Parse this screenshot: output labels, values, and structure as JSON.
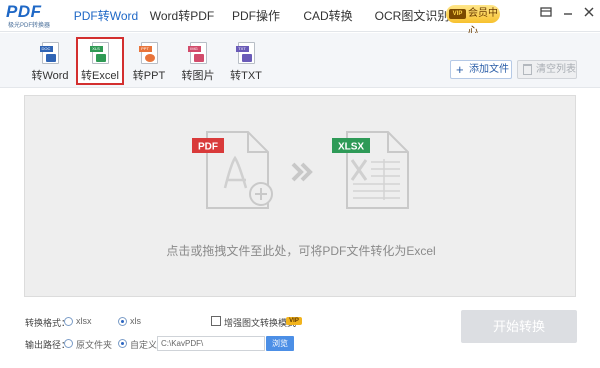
{
  "app": {
    "logo_text": "PDF",
    "logo_subtitle": "极光PDF转换器"
  },
  "tabs": [
    {
      "label": "PDF转Word",
      "active": true
    },
    {
      "label": "Word转PDF",
      "active": false
    },
    {
      "label": "PDF操作",
      "active": false
    },
    {
      "label": "CAD转换",
      "active": false
    },
    {
      "label": "OCR图文识别",
      "active": false
    }
  ],
  "header": {
    "vip_tag": "VIP",
    "vip_label": "会员中心",
    "icons": [
      "menu-icon",
      "minimize-icon",
      "close-icon"
    ]
  },
  "subtools": [
    {
      "label": "转Word",
      "badge": "DOC",
      "color": "#2f64b5",
      "selected": false
    },
    {
      "label": "转Excel",
      "badge": "XLS",
      "color": "#2f9a55",
      "selected": true
    },
    {
      "label": "转PPT",
      "badge": "PPT",
      "color": "#e8743b",
      "selected": false
    },
    {
      "label": "转图片",
      "badge": "IMG",
      "color": "#d24b6b",
      "selected": false
    },
    {
      "label": "转TXT",
      "badge": "TXT",
      "color": "#6a5bb8",
      "selected": false
    }
  ],
  "toolbar": {
    "add_label": "添加文件",
    "clear_label": "清空列表"
  },
  "dropzone": {
    "source_badge": "PDF",
    "target_badge": "XLSX",
    "hint": "点击或拖拽文件至此处，可将PDF文件转化为Excel"
  },
  "options": {
    "format_label": "转换格式：",
    "format_options": [
      "xlsx",
      "xls"
    ],
    "format_selected": "xls",
    "enhance_label": "增强图文转换模式",
    "enhance_checked": false,
    "enhance_vip": "VIP",
    "output_label": "输出路径：",
    "output_options": [
      "原文件夹",
      "自定义"
    ],
    "output_selected": "自定义",
    "path_value": "C:\\KavPDF\\",
    "browse_label": "浏览"
  },
  "start_label": "开始转换",
  "colors": {
    "accent": "#1f68c6",
    "pdf_red": "#d93a3a",
    "xlsx_green": "#2e9a57",
    "selected_border": "#d32f2f"
  }
}
